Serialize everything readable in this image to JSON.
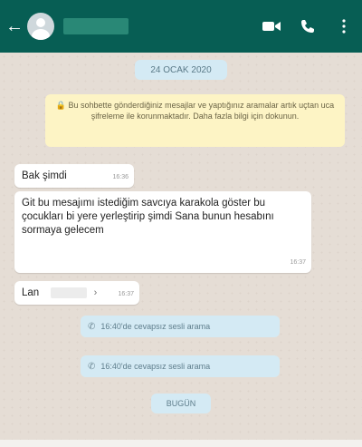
{
  "header": {
    "back_icon": "arrow-left-icon",
    "avatar_icon": "avatar-icon",
    "video_icon": "video-icon",
    "phone_icon": "phone-icon",
    "menu_icon": "more-vert-icon"
  },
  "chat": {
    "date": "24 OCAK 2020",
    "notice": "Bu sohbette gönderdiğiniz mesajlar ve yaptığınız aramalar artık uçtan uca şifreleme ile korunmaktadır. Daha fazla bilgi için dokunun.",
    "messages": [
      {
        "text": "Bak şimdi",
        "time": "16:36"
      },
      {
        "text": "Git bu mesajımı istediğim savcıya karakola göster bu çocukları bi yere yerleştirip şimdi Sana bunun hesabını sormaya gelecem",
        "time": "16:37"
      },
      {
        "text": "Lan",
        "time": "16:37"
      }
    ],
    "calls": [
      {
        "text": "16:40'de cevapsız sesli arama"
      },
      {
        "text": "16:40'de cevapsız sesli arama"
      }
    ],
    "today": "BUGÜN"
  },
  "colors": {
    "header": "#075e54",
    "chat_bg": "#e5ddd5",
    "bubble": "#ffffff",
    "notice": "#fdf4c5",
    "chip": "#d4eaf4"
  }
}
